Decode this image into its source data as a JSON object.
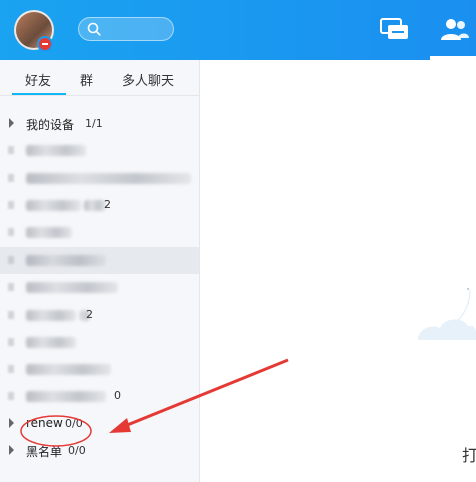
{
  "header": {
    "search_placeholder": "",
    "icons": [
      "avatar",
      "search-icon",
      "chat-icon",
      "contacts-icon"
    ],
    "brand_color": "#1a9bf0"
  },
  "tabs": [
    {
      "label": "好友"
    },
    {
      "label": "群"
    },
    {
      "label": "多人聊天"
    }
  ],
  "groups": [
    {
      "name": "我的设备",
      "count": "1/1"
    },
    {
      "name": "renew",
      "count": "0/0"
    },
    {
      "name": "黑名单",
      "count": "0/0"
    }
  ],
  "blurred_counts": [
    "2",
    "2",
    "0"
  ],
  "main": {
    "partial_text": "打"
  },
  "annotation": {
    "color": "#e53935"
  }
}
